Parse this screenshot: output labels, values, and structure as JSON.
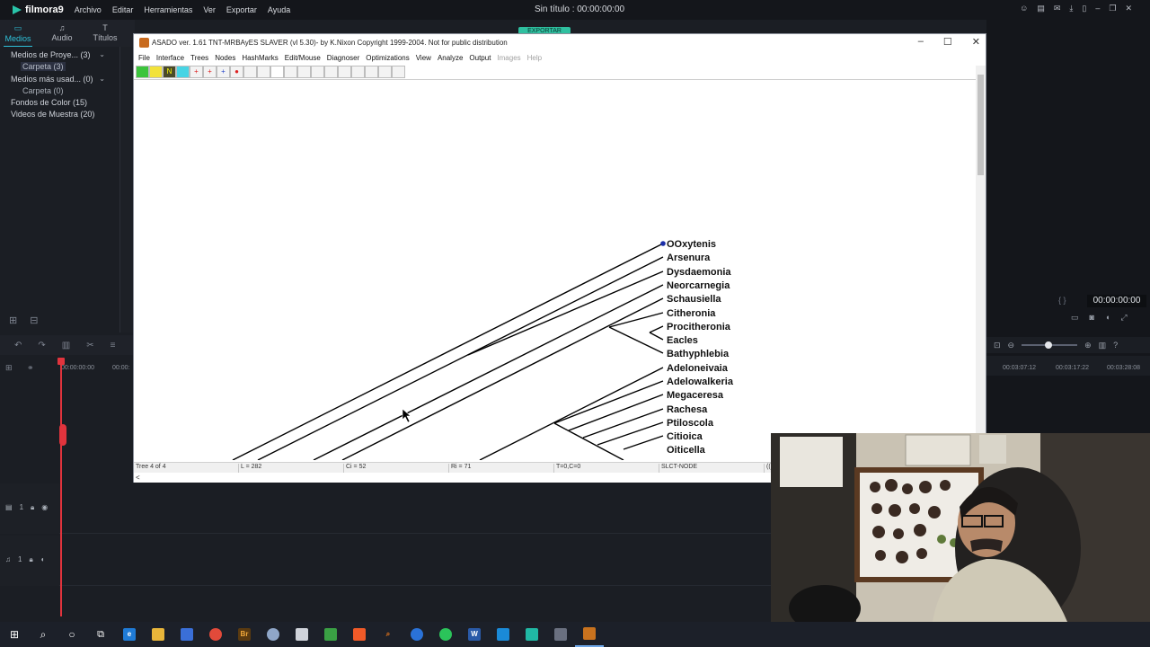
{
  "filmora": {
    "app_name": "filmora9",
    "menu": [
      "Archivo",
      "Editar",
      "Herramientas",
      "Ver",
      "Exportar",
      "Ayuda"
    ],
    "project_title": "Sin título : 00:00:00:00",
    "tabs": [
      {
        "label": "Medios",
        "icon": "folder-icon"
      },
      {
        "label": "Audio",
        "icon": "music-note-icon"
      },
      {
        "label": "Títulos",
        "icon": "text-icon"
      }
    ],
    "media_tree": [
      {
        "label": "Medios de Proye... (3)",
        "expanded": true
      },
      {
        "label": "Carpeta (3)",
        "selected": true
      },
      {
        "label": "Medios más usad... (0)",
        "expanded": true
      },
      {
        "label": "Carpeta (0)"
      },
      {
        "label": "Fondos de Color (15)"
      },
      {
        "label": "Videos de Muestra (20)"
      }
    ],
    "export_label": "EXPORTAR",
    "preview_time": "00:00:00:00",
    "timeline": {
      "ruler": [
        "00:00:00:00",
        "00:00:",
        "00:03:07:12",
        "00:03:17:22",
        "00:03:28:08"
      ],
      "tracks": [
        {
          "label": "1",
          "type": "video"
        },
        {
          "label": "1",
          "type": "audio"
        }
      ]
    }
  },
  "asado": {
    "title": "ASADO ver. 1.61 TNT-MRBAyES SLAVER (vl 5.30)- by K.Nixon Copyright 1999-2004. Not for public distribution",
    "menu": [
      "File",
      "Interface",
      "Trees",
      "Nodes",
      "HashMarks",
      "Edit/Mouse",
      "Diagnoser",
      "Optimizations",
      "View",
      "Analyze",
      "Output",
      "Images",
      "Help"
    ],
    "disabled_menu": [
      "Images",
      "Help"
    ],
    "toolbar_buttons": [
      "green",
      "yellow",
      "N",
      "cyan",
      "red-cross",
      "red-cross-2",
      "plus",
      "red-dot",
      "blank1",
      "blank2",
      "white",
      "blank3",
      "blank4",
      "blank5",
      "blank6",
      "blank7",
      "blank8",
      "blank9",
      "blank10",
      "blank11"
    ],
    "taxa": [
      "OOxytenis",
      "Arsenura",
      "Dysdaemonia",
      "Neorcarnegia",
      "Schausiella",
      "Citheronia",
      "Procitheronia",
      "Eacles",
      "Bathyphlebia",
      "Adeloneivaia",
      "Adelowalkeria",
      "Megaceresa",
      "Rachesa",
      "Ptiloscola",
      "Citioica",
      "Oiticella"
    ],
    "status": {
      "tree": "Tree 4 of 4",
      "length": "L = 282",
      "ci": "Ci = 52",
      "ri": "Ri = 71",
      "tc": "T=0,C=0",
      "mode": "SLCT-NODE",
      "extra": "(("
    },
    "scroll_left": "<"
  },
  "taskbar": {
    "apps": [
      "windows-start",
      "search",
      "cortana",
      "task-view",
      "edge",
      "file-explorer",
      "store",
      "chrome",
      "bridge",
      "misc",
      "calculator",
      "excel-green",
      "brave",
      "search-orange",
      "teamviewer",
      "whatsapp",
      "word",
      "photos",
      "filmora",
      "other",
      "asado"
    ]
  }
}
